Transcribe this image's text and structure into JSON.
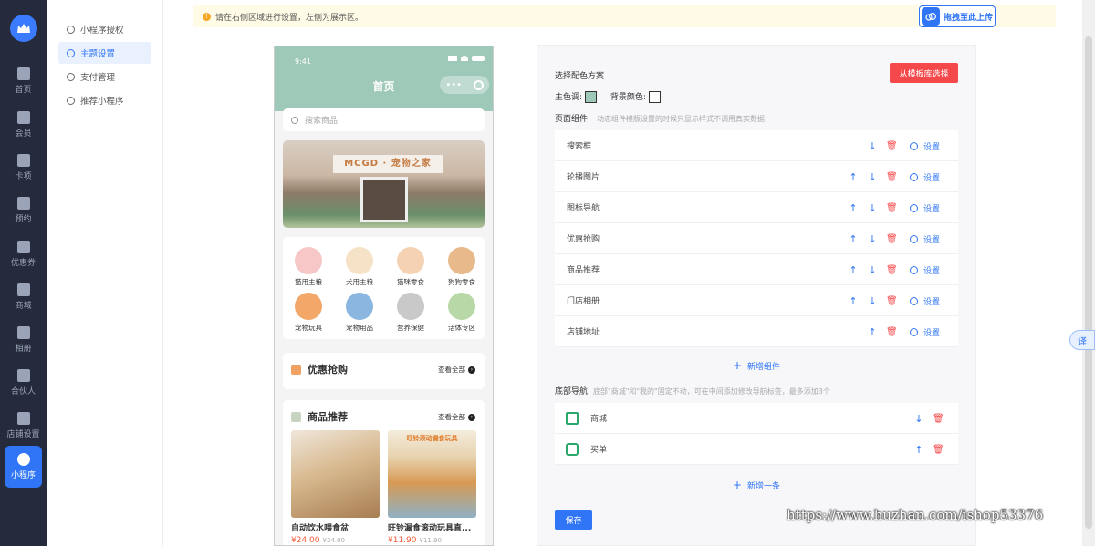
{
  "nav": {
    "items": [
      {
        "label": "首页"
      },
      {
        "label": "会员"
      },
      {
        "label": "卡项"
      },
      {
        "label": "预约"
      },
      {
        "label": "优惠券"
      },
      {
        "label": "商城"
      },
      {
        "label": "相册"
      },
      {
        "label": "合伙人"
      },
      {
        "label": "店铺设置"
      },
      {
        "label": "小程序"
      }
    ]
  },
  "subnav": {
    "items": [
      {
        "label": "小程序授权"
      },
      {
        "label": "主题设置"
      },
      {
        "label": "支付管理"
      },
      {
        "label": "推荐小程序"
      }
    ]
  },
  "notice": {
    "text": "请在右侧区域进行设置，左侧为展示区。",
    "upload_label": "拖拽至此上传"
  },
  "phone": {
    "time": "9:41",
    "title": "首页",
    "search_placeholder": "搜索商品",
    "banner_sign": "MCGD · 宠物之家",
    "categories": [
      {
        "label": "猫用主粮",
        "color": "#f7c7c7"
      },
      {
        "label": "犬用主粮",
        "color": "#f5e2c7"
      },
      {
        "label": "猫咪零食",
        "color": "#f5d2b4"
      },
      {
        "label": "狗狗零食",
        "color": "#e8b98a"
      },
      {
        "label": "宠物玩具",
        "color": "#f3a86a"
      },
      {
        "label": "宠物用品",
        "color": "#8ab6e0"
      },
      {
        "label": "营养保健",
        "color": "#c9c9c9"
      },
      {
        "label": "活体专区",
        "color": "#b8d8a8"
      }
    ],
    "deal_title": "优惠抢购",
    "see_all": "查看全部",
    "rec_title": "商品推荐",
    "products": [
      {
        "name": "自动饮水喂食盆",
        "price": "¥24.00",
        "old_price": "¥24.00",
        "color": "#c9a17a"
      },
      {
        "name": "旺铃漏食滚动玩具直...",
        "price": "¥11.90",
        "old_price": "¥11.90",
        "color": "#e9d7b8",
        "banner": "旺铃滚动漏食玩具"
      }
    ]
  },
  "panel": {
    "scheme_label": "选择配色方案",
    "template_button": "从模板库选择",
    "main_color_label": "主色调:",
    "main_color": "#9ec8b8",
    "bg_color_label": "背景颜色:",
    "bg_color": "#ffffff",
    "components_label": "页面组件",
    "components_hint": "动态组件模版设置的时候只显示样式不调用真实数据",
    "components": [
      {
        "name": "搜索框",
        "up": false,
        "down": true
      },
      {
        "name": "轮播图片",
        "up": true,
        "down": true
      },
      {
        "name": "图标导航",
        "up": true,
        "down": true
      },
      {
        "name": "优惠抢购",
        "up": true,
        "down": true
      },
      {
        "name": "商品推荐",
        "up": true,
        "down": true
      },
      {
        "name": "门店相册",
        "up": true,
        "down": true
      },
      {
        "name": "店铺地址",
        "up": true,
        "down": false
      }
    ],
    "setting_label": "设置",
    "add_component": "新增组件",
    "tabbar_label": "底部导航",
    "tabbar_hint": "底部\"商城\"和\"我的\"固定不动，可在中间添加修改导航标签，最多添加3个",
    "tabs": [
      {
        "name": "商城",
        "up": false,
        "down": true
      },
      {
        "name": "买单",
        "up": true,
        "down": false
      }
    ],
    "add_tab": "新增一条",
    "save": "保存"
  },
  "translate_label": "译",
  "watermark": "https://www.huzhan.com/ishop53376"
}
